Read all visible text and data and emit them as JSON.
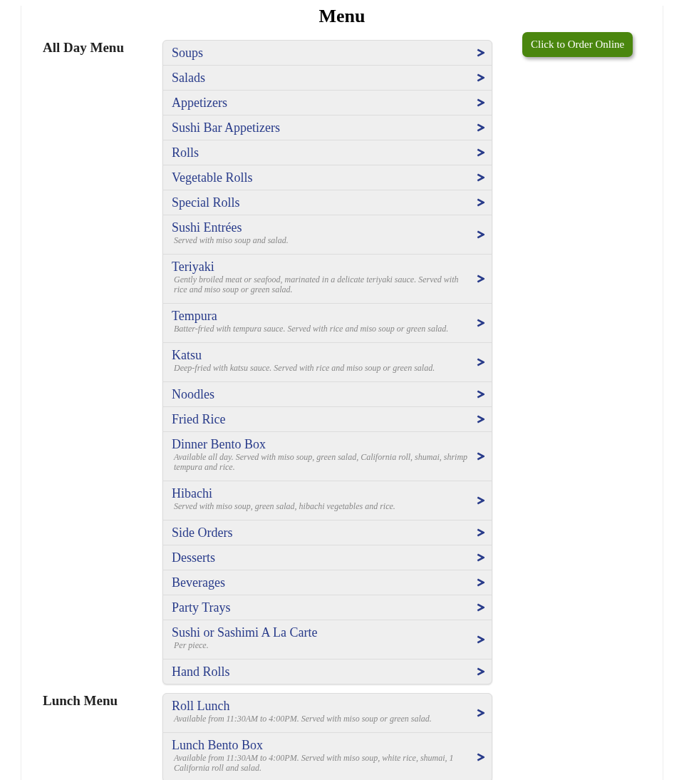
{
  "title": "Menu",
  "order_button": {
    "label": "Click to Order Online"
  },
  "sections": [
    {
      "heading": "All Day Menu",
      "items": [
        {
          "name": "Soups"
        },
        {
          "name": "Salads"
        },
        {
          "name": "Appetizers"
        },
        {
          "name": "Sushi Bar Appetizers"
        },
        {
          "name": "Rolls"
        },
        {
          "name": "Vegetable Rolls"
        },
        {
          "name": "Special Rolls"
        },
        {
          "name": "Sushi Entrées",
          "description": "Served with miso soup and salad."
        },
        {
          "name": "Teriyaki",
          "description": "Gently broiled meat or seafood, marinated in a delicate teriyaki sauce. Served with rice and miso soup or green salad."
        },
        {
          "name": "Tempura",
          "description": "Batter-fried with tempura sauce. Served with rice and miso soup or green salad."
        },
        {
          "name": "Katsu",
          "description": "Deep-fried with katsu sauce. Served with rice and miso soup or green salad."
        },
        {
          "name": "Noodles"
        },
        {
          "name": "Fried Rice"
        },
        {
          "name": "Dinner Bento Box",
          "description": "Available all day. Served with miso soup, green salad, California roll, shumai, shrimp tempura and rice."
        },
        {
          "name": "Hibachi",
          "description": "Served with miso soup, green salad, hibachi vegetables and rice."
        },
        {
          "name": "Side Orders"
        },
        {
          "name": "Desserts"
        },
        {
          "name": "Beverages"
        },
        {
          "name": "Party Trays"
        },
        {
          "name": "Sushi or Sashimi A La Carte",
          "description": "Per piece."
        },
        {
          "name": "Hand Rolls"
        }
      ]
    },
    {
      "heading": "Lunch Menu",
      "items": [
        {
          "name": "Roll Lunch",
          "description": "Available from 11:30AM to 4:00PM. Served with miso soup or green salad."
        },
        {
          "name": "Lunch Bento Box",
          "description": "Available from 11:30AM to 4:00PM. Served with miso soup, white rice, shumai, 1 California roll and salad."
        }
      ]
    }
  ]
}
